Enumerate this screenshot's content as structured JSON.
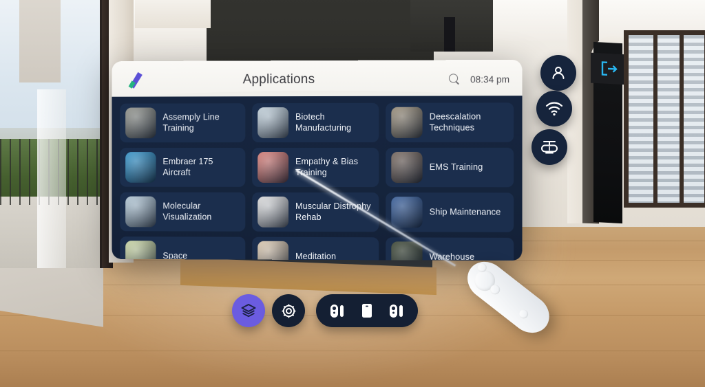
{
  "app": {
    "title": "Applications",
    "logo_name": "quantum-xr-logo",
    "clock": "08:34 pm",
    "search_icon": "search-icon"
  },
  "colors": {
    "panel_header_bg": "#faf9f6",
    "panel_body_bg": "#16253f",
    "card_bg": "#1b2e4d",
    "accent_purple": "#6b5ce0",
    "orb_bg": "#16243c",
    "label_text": "#f0f3f8",
    "exit_sign": "#29b6f0"
  },
  "applications": [
    {
      "label": "Assemply Line Training",
      "icon": "factory-workers-thumbnail",
      "tone": "#8d8f86"
    },
    {
      "label": "Biotech Manufacturing",
      "icon": "lab-scientist-thumbnail",
      "tone": "#cfe2ee"
    },
    {
      "label": "Deescalation Techniques",
      "icon": "vr-officer-thumbnail",
      "tone": "#9a8b72"
    },
    {
      "label": "Embraer 175 Aircraft",
      "icon": "airplane-thumbnail",
      "tone": "#1a93d8"
    },
    {
      "label": "Empathy & Bias Training",
      "icon": "two-faces-thumbnail",
      "tone": "#e8766e"
    },
    {
      "label": "EMS Training",
      "icon": "ambulance-thumbnail",
      "tone": "#6d5a4e"
    },
    {
      "label": "Molecular Visualization",
      "icon": "molecule-lab-thumbnail",
      "tone": "#b9d4e6"
    },
    {
      "label": "Muscular Distrophy Rehab",
      "icon": "yoga-person-thumbnail",
      "tone": "#f1f1f1"
    },
    {
      "label": "Ship Maintenance",
      "icon": "ship-game-thumbnail",
      "tone": "#1f4f9b"
    },
    {
      "label": "Space",
      "icon": "space-thumbnail",
      "tone": "#d8e8a8"
    },
    {
      "label": "Meditation",
      "icon": "meditation-thumbnail",
      "tone": "#f0d8b8"
    },
    {
      "label": "Warehouse",
      "icon": "warehouse-thumbnail",
      "tone": "#243018"
    }
  ],
  "status_orbs": [
    {
      "name": "profile-orb",
      "icon": "user-icon"
    },
    {
      "name": "wifi-orb",
      "icon": "wifi-icon"
    },
    {
      "name": "headset-orb",
      "icon": "vr-headset-icon"
    }
  ],
  "toolbar": {
    "layers_label": "layers-icon",
    "settings_label": "gear-icon",
    "devices": [
      {
        "name": "left-controller",
        "icon": "vr-controller-icon"
      },
      {
        "name": "headset-screen",
        "icon": "tablet-icon"
      },
      {
        "name": "right-controller",
        "icon": "vr-controller-icon"
      }
    ]
  },
  "environment": {
    "exit_sign_icon": "exit-door-icon",
    "controller_name": "vr-controller-3d",
    "pointer_name": "laser-pointer-ray"
  }
}
